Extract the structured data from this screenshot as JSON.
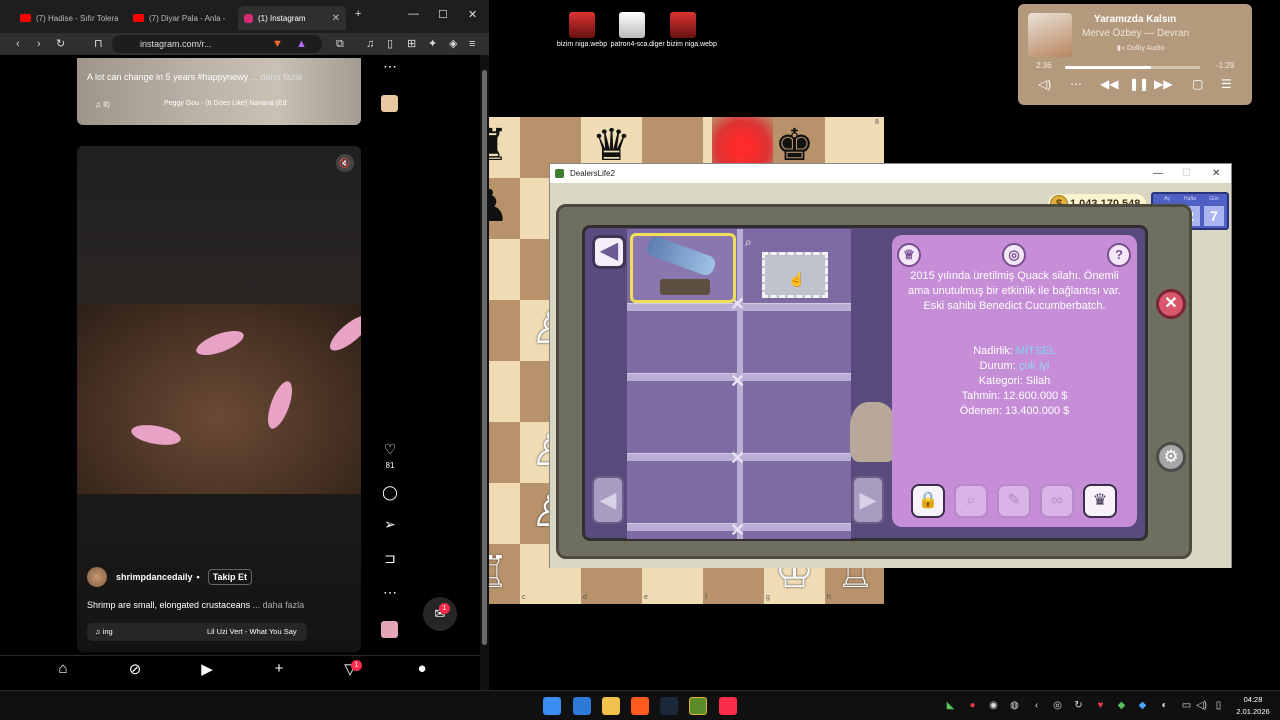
{
  "browser": {
    "tabs": [
      {
        "label": "(7) Hadise - Sıfır Tolera",
        "color": "#ff0000"
      },
      {
        "label": "(7) Diyar Pala - Anla -",
        "color": "#ff0000"
      },
      {
        "label": "(1) Instagram",
        "color": "#d62976"
      }
    ],
    "url": "instagram.com/r...",
    "post1": {
      "caption": "A lot can change in 5 years #happynewy",
      "more": "... daha fazla",
      "music": "♫ it)",
      "song": "Peggy Gou - (It Goes Like) Nanana (Ed"
    },
    "reel": {
      "username": "shrimpdancedaily",
      "separator": "•",
      "follow": "Takip Et",
      "caption": "Shrimp are small, elongated crustaceans",
      "more": "... daha fazla",
      "music": "♫ ing",
      "song": "Lil Uzi Vert - What You Say",
      "likes": "81",
      "notif_count": "1"
    }
  },
  "desktop_icons": [
    {
      "label": "bizim niga.webp"
    },
    {
      "label": "patron4-sca..."
    },
    {
      "label": "diger bizim niga.webp"
    }
  ],
  "media": {
    "title": "Yaramızda Kalsın",
    "artist": "Merve Özbey — Devran",
    "badge": "Dolby Audio",
    "elapsed": "2:36",
    "remaining": "-1:29",
    "progress": 0.64
  },
  "chess": {
    "files": [
      "c",
      "d",
      "e",
      "f",
      "g",
      "h"
    ],
    "rank_top": "8"
  },
  "game": {
    "window_title": "DealersLife2",
    "money": "1.043.170.548",
    "date": {
      "labels": [
        "Ay",
        "Hafta",
        "Gün"
      ],
      "values": [
        "87",
        "2",
        "7"
      ]
    },
    "description": "2015 yılında üretilmiş Quack silahı. Önemli ama unutulmuş bir etkinlik ile bağlantısı var. Eski sahibi Benedict Cucumberbatch.",
    "rarity_label": "Nadirlik:",
    "rarity_value": "MİTSEL",
    "condition_label": "Durum:",
    "condition_value": "çok iyi",
    "category": "Kategori: Silah",
    "estimate": "Tahmin: 12.600.000 $",
    "paid": "Ödenen: 13.400.000 $"
  },
  "taskbar": {
    "time": "04:28",
    "date": "2.01.2026"
  }
}
